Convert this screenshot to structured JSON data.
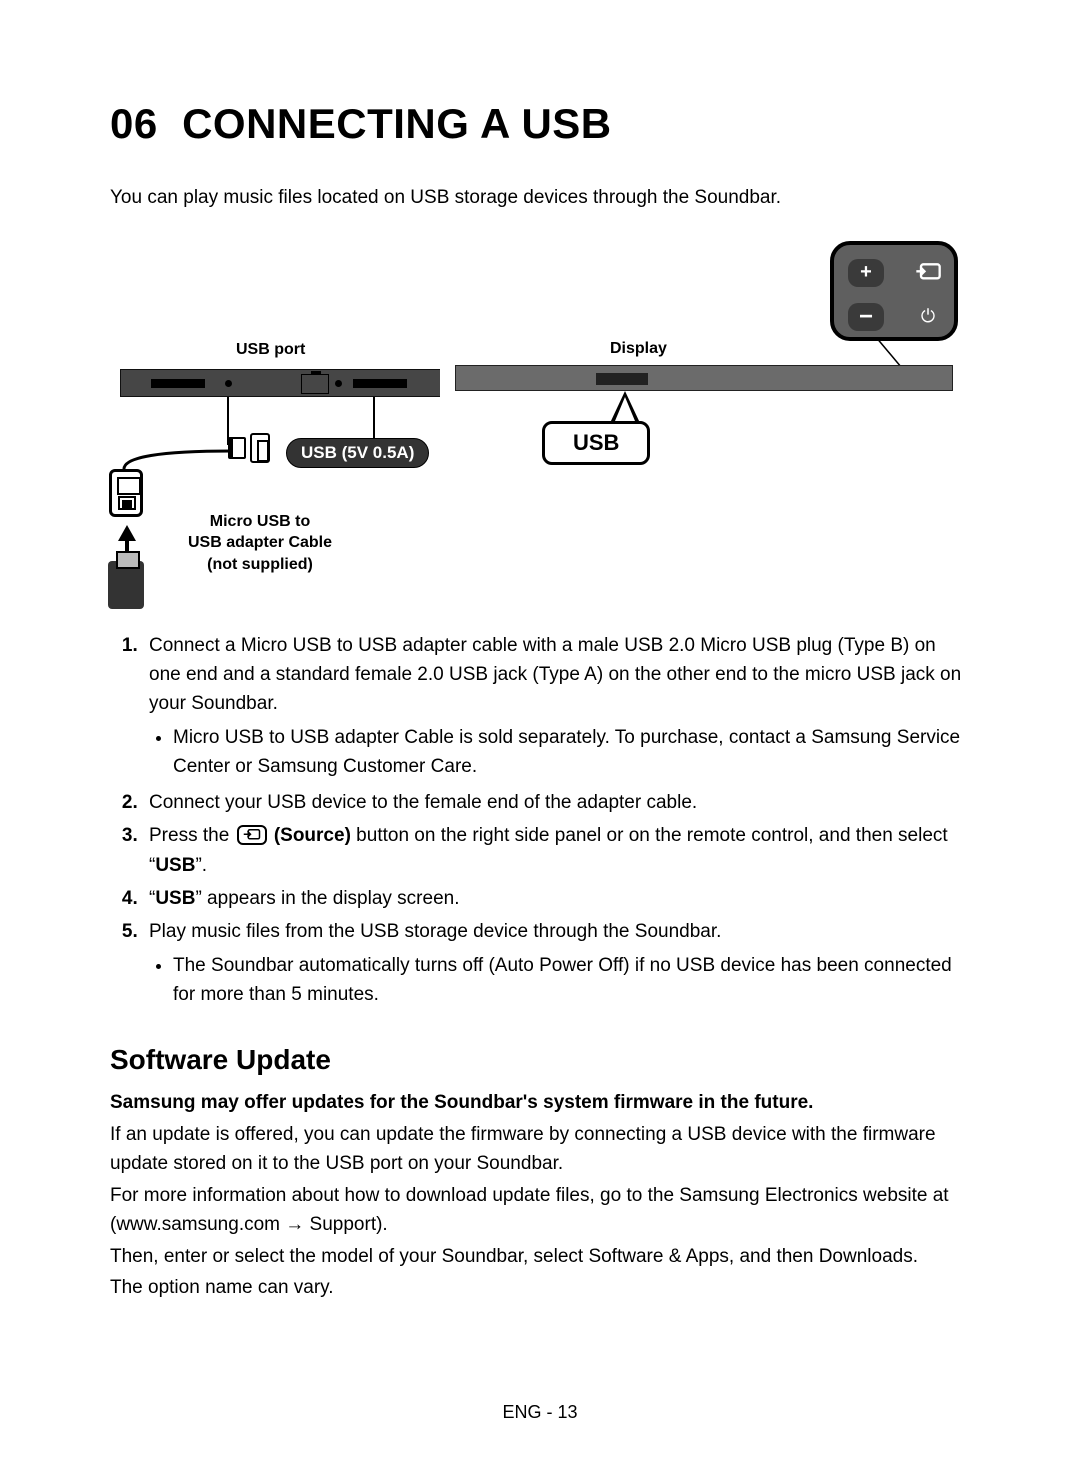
{
  "section": {
    "number": "06",
    "title": "CONNECTING A USB"
  },
  "intro": "You can play music files located on USB storage devices through the Soundbar.",
  "diagram": {
    "usb_port_label": "USB port",
    "usb_power_label": "USB (5V 0.5A)",
    "adapter_label_line1": "Micro USB to",
    "adapter_label_line2": "USB adapter Cable",
    "adapter_label_line3": "(not supplied)",
    "display_label": "Display",
    "usb_bubble": "USB",
    "remote": {
      "plus": "+",
      "minus": "−",
      "power": "⏻"
    }
  },
  "steps": {
    "s1": "Connect a Micro USB to USB adapter cable with a male USB 2.0 Micro USB plug (Type B) on one end and a standard female 2.0 USB jack (Type A) on the other end to the micro USB jack on your Soundbar.",
    "s1_bullet": "Micro USB to USB adapter Cable is sold separately. To purchase, contact a Samsung Service Center or Samsung Customer Care.",
    "s2": "Connect your USB device to the female end of the adapter cable.",
    "s3_a": "Press the ",
    "s3_source_bold": "(Source)",
    "s3_b": " button on the right side panel or on the remote control, and then select “",
    "s3_usb": "USB",
    "s3_c": "”.",
    "s4_a": "“",
    "s4_usb": "USB",
    "s4_b": "” appears in the display screen.",
    "s5": "Play music files from the USB storage device through the Soundbar.",
    "s5_bullet": "The Soundbar automatically turns off (Auto Power Off) if no USB device has been connected for more than 5 minutes."
  },
  "software_update": {
    "heading": "Software Update",
    "bold": "Samsung may offer updates for the Soundbar's system firmware in the future.",
    "p1": "If an update is offered, you can update the firmware by connecting a USB device with the firmware update stored on it to the USB port on your Soundbar.",
    "p2_a": "For more information about how to download update files, go to the Samsung Electronics website at (www.samsung.com ",
    "p2_arrow": "→",
    "p2_b": " Support).",
    "p3": "Then, enter or select the model of your Soundbar, select Software & Apps, and then Downloads.",
    "p4": "The option name can vary."
  },
  "footer": "ENG - 13"
}
